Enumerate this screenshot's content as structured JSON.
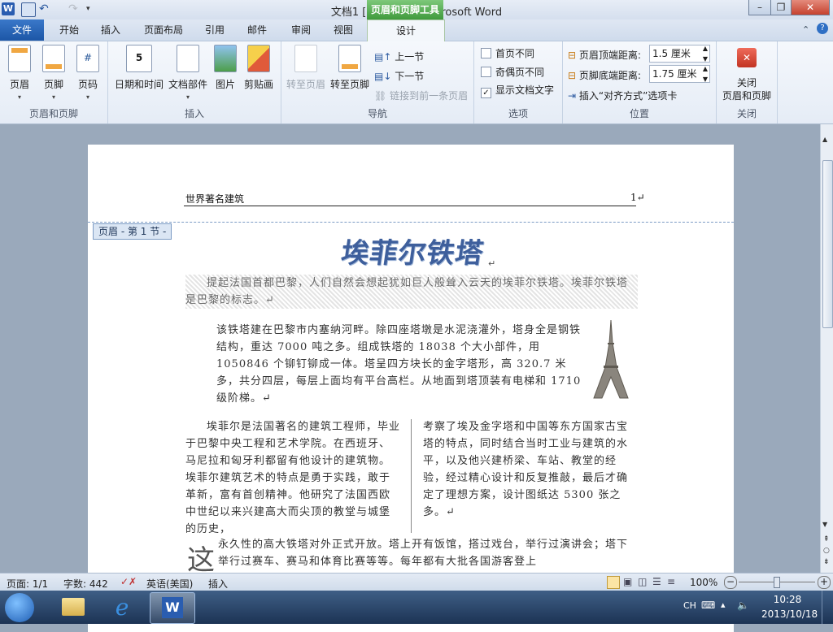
{
  "window": {
    "title": "文档1 [兼容模式] - Microsoft Word",
    "contextual_header": "页眉和页脚工具"
  },
  "tabs": [
    "文件",
    "开始",
    "插入",
    "页面布局",
    "引用",
    "邮件",
    "审阅",
    "视图",
    "设计"
  ],
  "ribbon": {
    "group_header_footer": {
      "label": "页眉和页脚",
      "buttons": [
        "页眉",
        "页脚",
        "页码"
      ]
    },
    "group_insert": {
      "label": "插入",
      "buttons": [
        "日期和时间",
        "文档部件",
        "图片",
        "剪贴画"
      ]
    },
    "group_nav": {
      "label": "导航",
      "goto_header": "转至页眉",
      "goto_footer": "转至页脚",
      "prev": "上一节",
      "next": "下一节",
      "link_prev": "链接到前一条页眉"
    },
    "group_options": {
      "label": "选项",
      "first_page": "首页不同",
      "odd_even": "奇偶页不同",
      "show_text": "显示文档文字"
    },
    "group_position": {
      "label": "位置",
      "header_top_label": "页眉顶端距离:",
      "header_top_value": "1.5 厘米",
      "footer_bottom_label": "页脚底端距离:",
      "footer_bottom_value": "1.75 厘米",
      "insert_align_tab": "插入“对齐方式”选项卡"
    },
    "group_close": {
      "label": "关闭",
      "close_line1": "关闭",
      "close_line2": "页眉和页脚"
    }
  },
  "document": {
    "header_text": "世界著名建筑",
    "header_page_num": "1↵",
    "header_tag": "页眉 - 第 1 节 -",
    "wordart": "埃菲尔铁塔",
    "para1": "提起法国首都巴黎，人们自然会想起犹如巨人般耸入云天的埃菲尔铁塔。埃菲尔铁塔是巴黎的标志。↵",
    "para2": "该铁塔建在巴黎市内塞纳河畔。除四座塔墩是水泥浇灌外，塔身全是钢铁结构，重达 7000 吨之多。组成铁塔的 18038 个大小部件，用 1050846 个铆钉铆成一体。塔呈四方块长的金字塔形，高 320.7 米多，共分四层，每层上面均有平台高栏。从地面到塔顶装有电梯和 1710 级阶梯。↵",
    "col_left": "埃菲尔是法国著名的建筑工程师，毕业于巴黎中央工程和艺术学院。在西班牙、马尼拉和匈牙利都留有他设计的建筑物。埃菲尔建筑艺术的特点是勇于实践，敢于革新，富有首创精神。他研究了法国西欧中世纪以来兴建高大而尖顶的教堂与城堡的历史，",
    "col_right": "考察了埃及金字塔和中国等东方国家古宝塔的特点，同时结合当时工业与建筑的水平，以及他兴建桥梁、车站、教堂的经验，经过精心设计和反复推敲，最后才确定了理想方案，设计图纸达 5300 张之多。↵",
    "dropcap": "这",
    "para_last": "永久性的高大铁塔对外正式开放。塔上开有饭馆，搭过戏台，举行过演讲会；塔下举行过赛车、赛马和体育比赛等等。每年都有大批各国游客登上"
  },
  "statusbar": {
    "page": "页面: 1/1",
    "words": "字数: 442",
    "language": "英语(美国)",
    "mode": "插入",
    "zoom": "100%"
  },
  "tray": {
    "lang": "CH",
    "time": "10:28",
    "date": "2013/10/18"
  },
  "colors": {
    "file_tab": "#2a67b8",
    "contextual_green": "#4fa84b",
    "close_red": "#d23a2c"
  }
}
